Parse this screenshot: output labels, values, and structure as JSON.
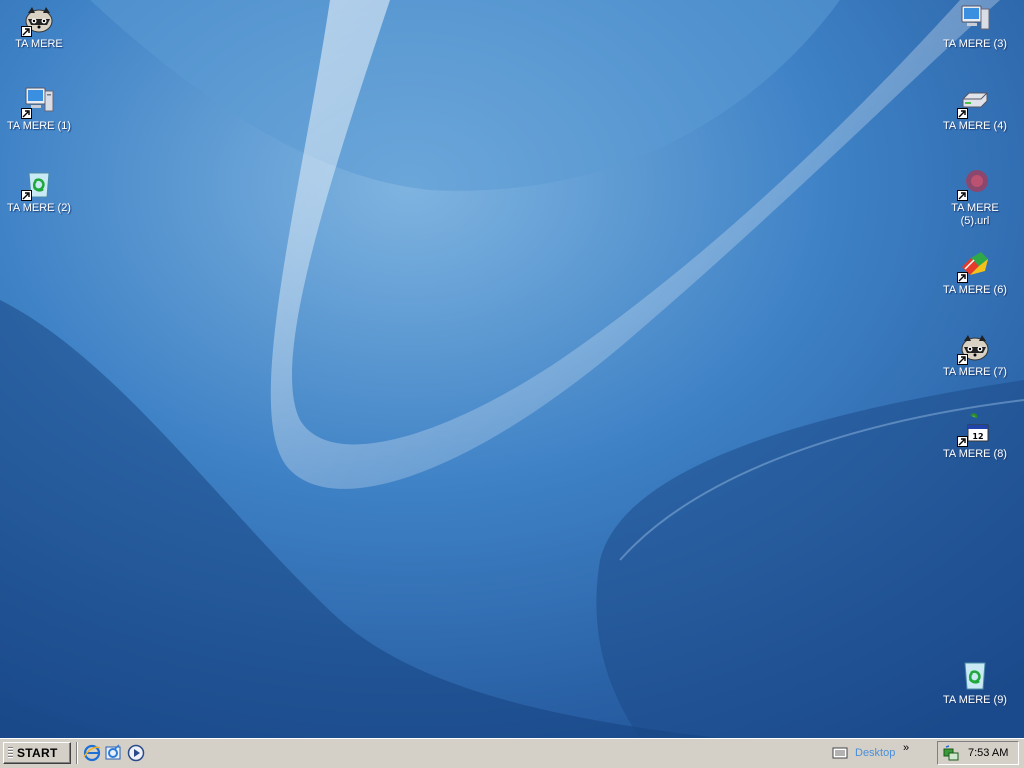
{
  "desktop": {
    "icons_left": [
      {
        "label": "TA MERE",
        "icon": "raccoon-icon"
      },
      {
        "label": "TA MERE (1)",
        "icon": "my-computer-icon"
      },
      {
        "label": "TA MERE (2)",
        "icon": "recycle-bin-icon"
      }
    ],
    "icons_right": [
      {
        "label": "TA MERE (3)",
        "icon": "my-computer-icon"
      },
      {
        "label": "TA MERE (4)",
        "icon": "drive-icon"
      },
      {
        "label": "TA MERE\n(5).url",
        "icon": "url-shortcut-icon"
      },
      {
        "label": "TA MERE (6)",
        "icon": "colorful-app-icon"
      },
      {
        "label": "TA MERE (7)",
        "icon": "raccoon-icon"
      },
      {
        "label": "TA MERE (8)",
        "icon": "calendar-app-icon"
      },
      {
        "label": "TA MERE (9)",
        "icon": "recycle-bin-icon"
      }
    ]
  },
  "taskbar": {
    "start_label": "START",
    "quick_launch": [
      "internet-explorer-icon",
      "outlook-express-icon",
      "media-player-icon"
    ],
    "desktop_toolbar_label": "Desktop",
    "chevron": "»",
    "tray_icon": "network-icon",
    "clock": "7:53 AM"
  },
  "colors": {
    "wallpaper_dark": "#1d4d92",
    "wallpaper_light": "#8fbde3",
    "taskbar": "#d4d0c8"
  }
}
